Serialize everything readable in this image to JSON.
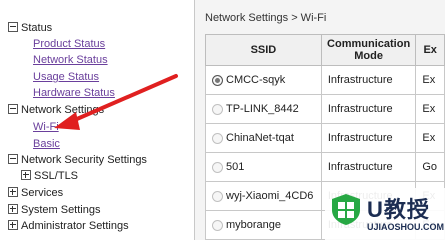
{
  "sidebar": {
    "status": {
      "label": "Status",
      "links": [
        "Product Status",
        "Network Status",
        "Usage Status",
        "Hardware Status"
      ]
    },
    "network_settings": {
      "label": "Network Settings",
      "links": [
        "Wi-Fi",
        "Basic"
      ]
    },
    "network_security": {
      "label": "Network Security Settings",
      "children": [
        "SSL/TLS"
      ]
    },
    "groups": [
      "Services",
      "System Settings",
      "Administrator Settings"
    ]
  },
  "main": {
    "breadcrumb": "Network Settings > Wi-Fi",
    "table": {
      "headers": [
        "SSID",
        "Communication Mode",
        "Ex"
      ],
      "rows": [
        {
          "ssid": "CMCC-sqyk",
          "mode": "Infrastructure",
          "extra": "Ex",
          "selected": true
        },
        {
          "ssid": "TP-LINK_8442",
          "mode": "Infrastructure",
          "extra": "Ex",
          "selected": false
        },
        {
          "ssid": "ChinaNet-tqat",
          "mode": "Infrastructure",
          "extra": "Ex",
          "selected": false
        },
        {
          "ssid": "501",
          "mode": "Infrastructure",
          "extra": "Go",
          "selected": false
        },
        {
          "ssid": "wyj-Xiaomi_4CD6",
          "mode": "Infrastructure",
          "extra": "Ex",
          "selected": false
        },
        {
          "ssid": "myborange",
          "mode": "Infrastructure",
          "extra": "Ex",
          "selected": false
        }
      ]
    }
  },
  "annotation": {
    "arrow_color": "#e02020"
  },
  "watermark": {
    "title": "U教授",
    "url": "UJIAOSHOU.COM"
  },
  "colors": {
    "link": "#6a3f9c",
    "main_bg": "#f4f4f4",
    "header_bg": "#f0f0f0",
    "logo_green": "#27a844"
  }
}
